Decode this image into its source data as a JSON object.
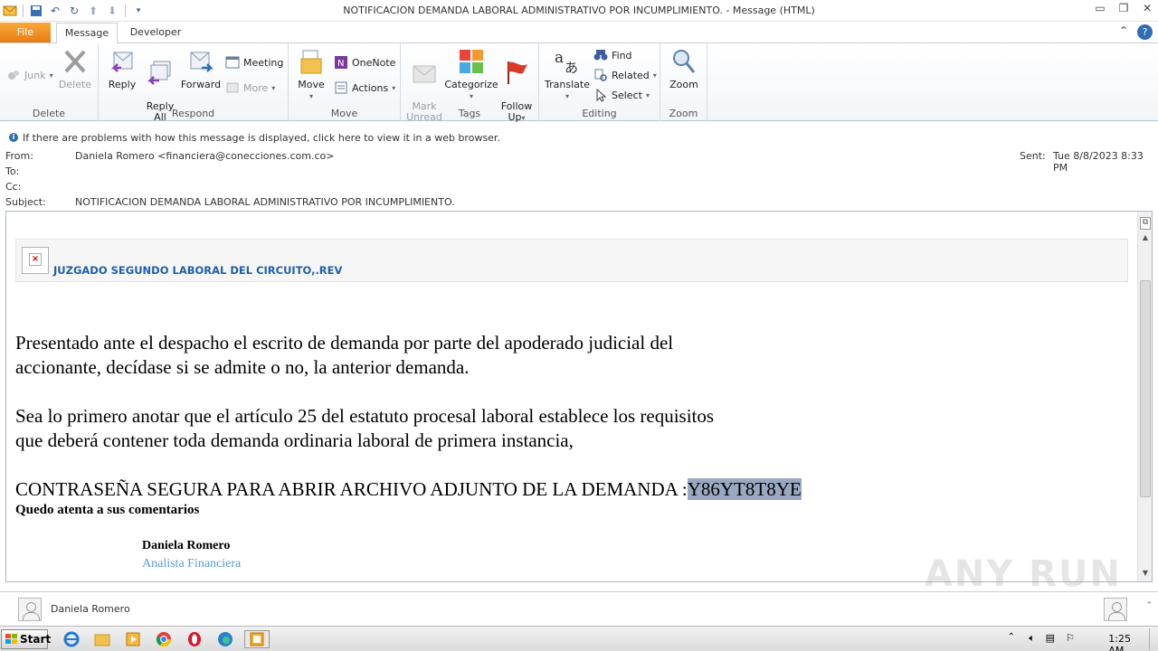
{
  "window": {
    "title": "NOTIFICACION DEMANDA LABORAL ADMINISTRATIVO POR INCUMPLIMIENTO.  -  Message (HTML)"
  },
  "tabs": {
    "file": "File",
    "message": "Message",
    "developer": "Developer"
  },
  "ribbon": {
    "delete_group": {
      "label": "Delete",
      "junk": "Junk",
      "delete": "Delete"
    },
    "respond_group": {
      "label": "Respond",
      "reply": "Reply",
      "reply_all": "Reply\nAll",
      "forward": "Forward",
      "meeting": "Meeting",
      "more": "More"
    },
    "move_group": {
      "label": "Move",
      "move": "Move",
      "onenote": "OneNote",
      "actions": "Actions"
    },
    "tags_group": {
      "label": "Tags",
      "mark_unread": "Mark\nUnread",
      "categorize": "Categorize",
      "follow_up": "Follow\nUp"
    },
    "editing_group": {
      "label": "Editing",
      "translate": "Translate",
      "find": "Find",
      "related": "Related",
      "select": "Select"
    },
    "zoom_group": {
      "label": "Zoom",
      "zoom": "Zoom"
    }
  },
  "infobar": "If there are problems with how this message is displayed, click here to view it in a web browser.",
  "header": {
    "from_label": "From:",
    "from_value": "Daniela Romero <financiera@conecciones.com.co>",
    "to_label": "To:",
    "cc_label": "Cc:",
    "subject_label": "Subject:",
    "subject_value": "NOTIFICACION DEMANDA LABORAL ADMINISTRATIVO POR INCUMPLIMIENTO.",
    "sent_label": "Sent:",
    "sent_value": "Tue 8/8/2023 8:33 PM"
  },
  "body": {
    "court": "JUZGADO SEGUNDO LABORAL DEL CIRCUITO,.REV",
    "para1_line1": "Presentado ante el despacho el escrito de demanda por parte del apoderado judicial del",
    "para1_line2": "accionante, decídase si se admite o no, la anterior demanda.",
    "para2_line1": "Sea lo primero anotar que el artículo 25 del estatuto procesal laboral establece los requisitos",
    "para2_line2": "que deberá contener toda demanda ordinaria laboral de primera instancia,",
    "password_label": "CONTRASEÑA SEGURA PARA ABRIR ARCHIVO ADJUNTO DE LA DEMANDA :",
    "password_value": "Y86YT8T8YE",
    "closing": "Quedo atenta a sus comentarios",
    "sig_name": "Daniela Romero",
    "sig_title": "Analista Financiera"
  },
  "people_pane": {
    "name": "Daniela Romero"
  },
  "taskbar": {
    "start": "Start",
    "clock": "1:25 AM"
  },
  "watermark": "ANY RUN"
}
